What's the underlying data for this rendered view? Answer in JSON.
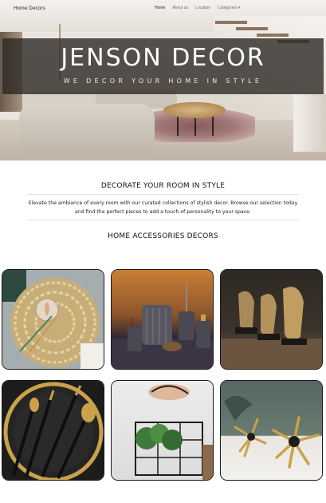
{
  "nav": {
    "brand": "Home Decors",
    "links": [
      {
        "label": "Home",
        "active": true
      },
      {
        "label": "About us",
        "active": false
      },
      {
        "label": "Location",
        "active": false
      },
      {
        "label": "Categories ▾",
        "active": false
      }
    ]
  },
  "hero": {
    "title": "JENSON DECOR",
    "tagline": "WE DECOR YOUR HOME IN STYLE"
  },
  "section_intro": {
    "heading": "DECORATE YOUR ROOM IN STYLE",
    "text_line1": "Elevate the ambiance of every room with our curated collections of stylish decor. Browse our selection today",
    "text_line2": "and find the perfect pieces to add a touch of personality to your space."
  },
  "section_products": {
    "heading": "HOME ACCESSORIES DECORS"
  },
  "colors": {
    "banner": "#2d2926",
    "accent_gold": "#c9a24a",
    "card_border": "#1a1a1a"
  }
}
